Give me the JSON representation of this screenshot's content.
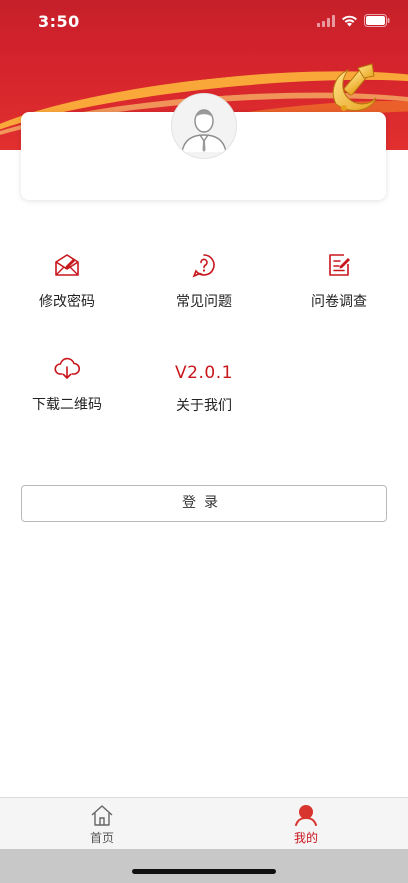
{
  "status_bar": {
    "time": "3:50"
  },
  "menu": {
    "items": [
      {
        "label": "修改密码",
        "icon": "envelope-edit-icon"
      },
      {
        "label": "常见问题",
        "icon": "question-bubble-icon"
      },
      {
        "label": "问卷调查",
        "icon": "survey-edit-icon"
      },
      {
        "label": "下载二维码",
        "icon": "cloud-download-icon"
      },
      {
        "label": "关于我们",
        "version": "V2.0.1"
      }
    ]
  },
  "login": {
    "label": "登录"
  },
  "tabbar": {
    "items": [
      {
        "label": "首页",
        "icon": "home-icon",
        "active": false
      },
      {
        "label": "我的",
        "icon": "profile-icon",
        "active": true
      }
    ]
  },
  "colors": {
    "brand_red": "#c8161d",
    "banner_red": "#d4232c",
    "tab_active": "#c8161d",
    "tab_inactive": "#555555"
  }
}
